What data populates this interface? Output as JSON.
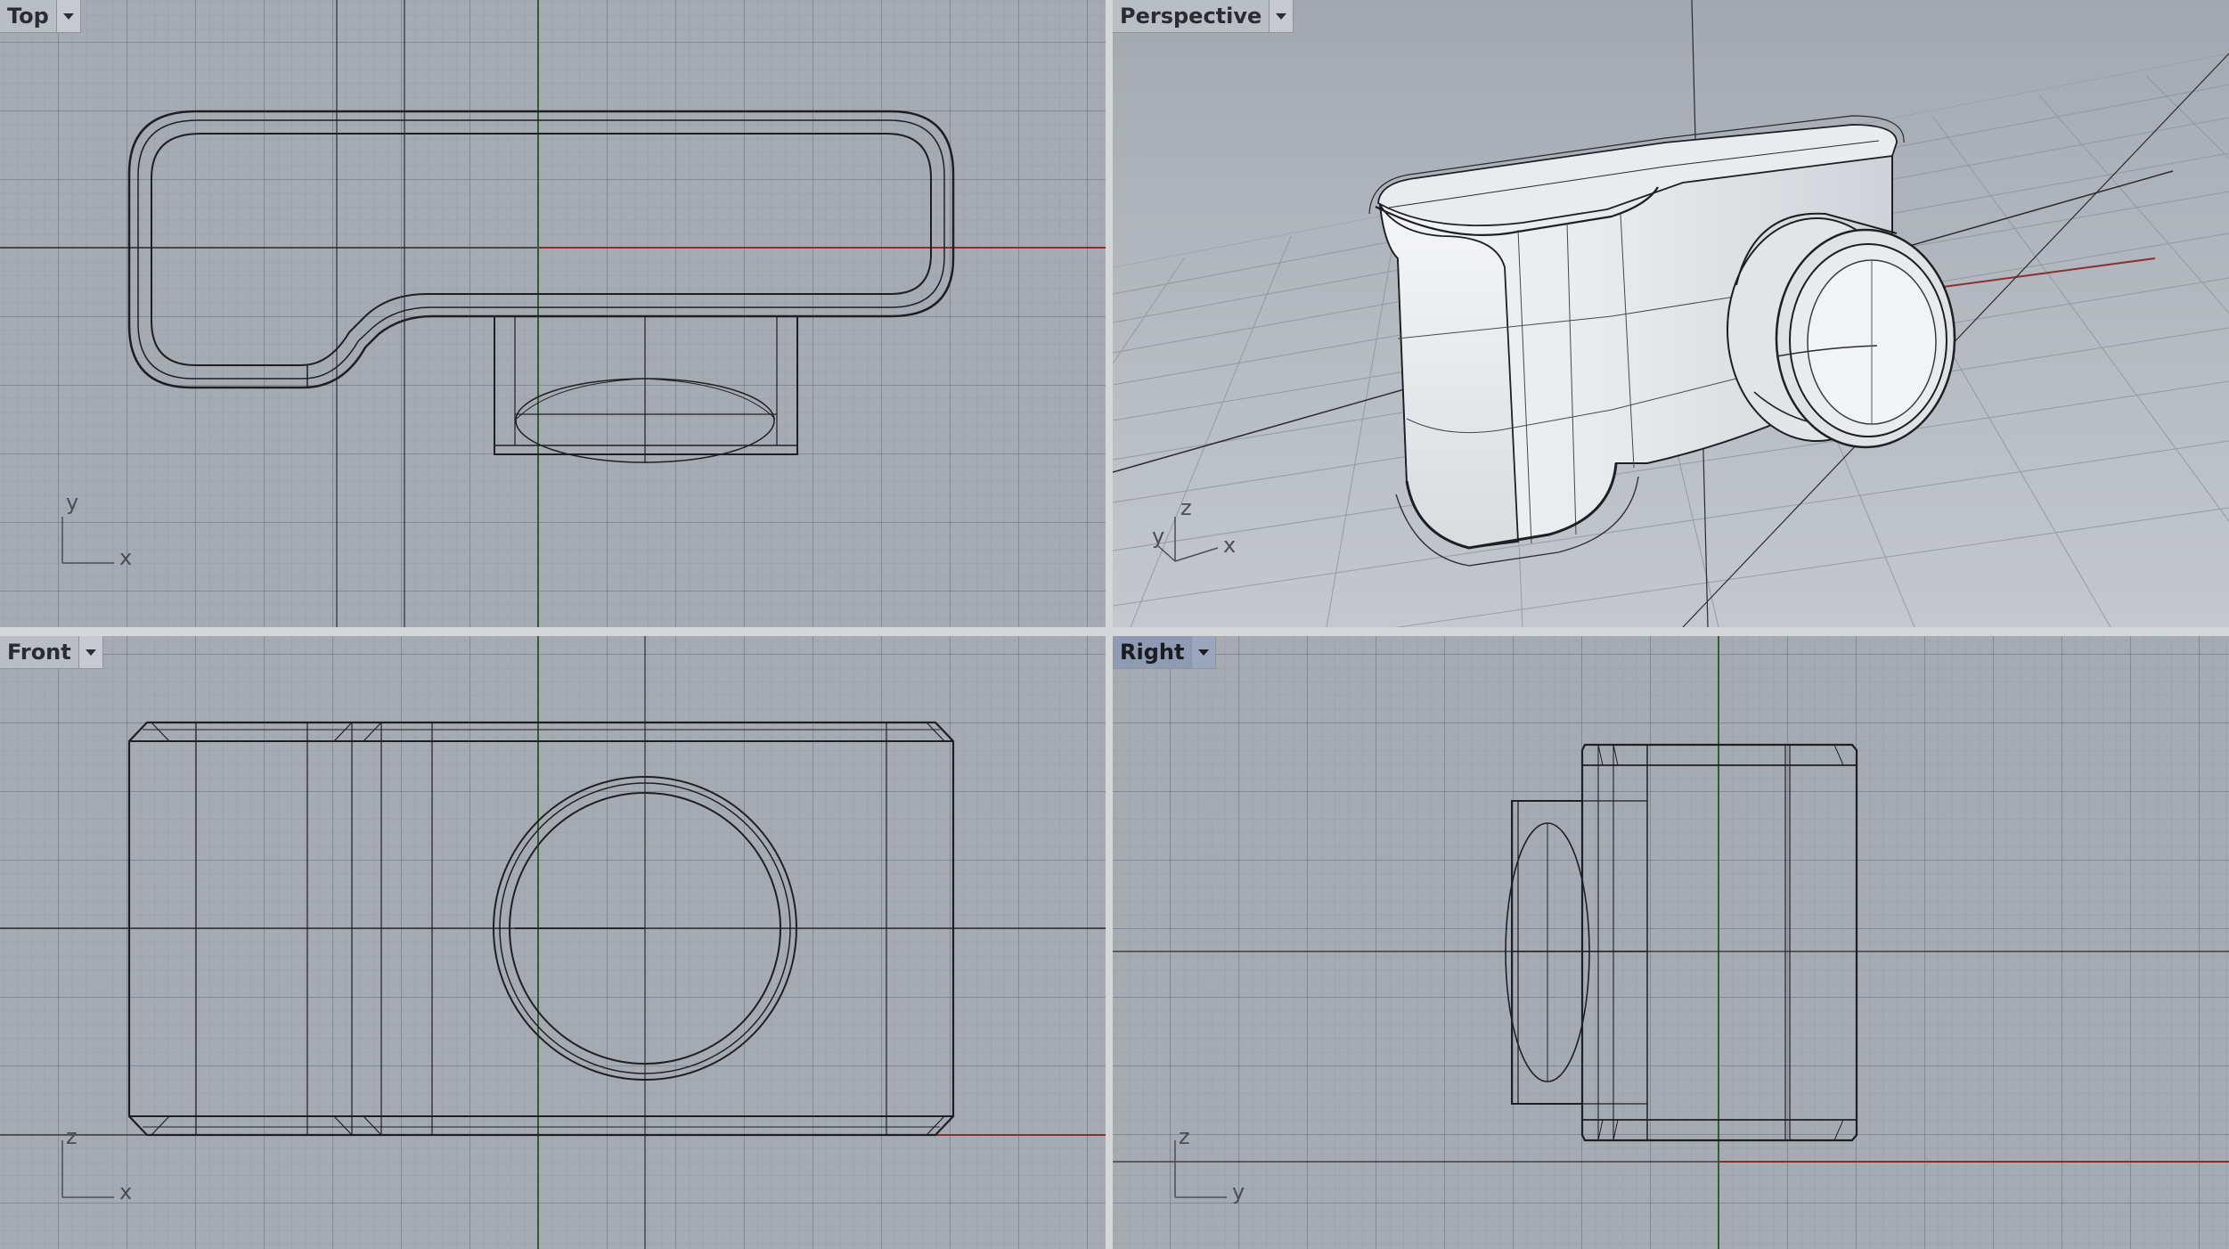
{
  "viewports": {
    "top": {
      "title": "Top",
      "axis_h": "x",
      "axis_v": "y"
    },
    "perspective": {
      "title": "Perspective",
      "axis_x": "x",
      "axis_y": "y",
      "axis_z": "z"
    },
    "front": {
      "title": "Front",
      "axis_h": "x",
      "axis_v": "z"
    },
    "right": {
      "title": "Right",
      "axis_h": "y",
      "axis_v": "z"
    }
  },
  "active_viewport": "right",
  "icons": {
    "menu": "chevron-down-icon"
  },
  "colors": {
    "viewport_bg": "#a6abb3",
    "grid_major": "#6e747e",
    "axis_x": "#8a2e2e",
    "axis_y": "#2f5f2f",
    "wire": "#1e1f22",
    "active_tab": "#8e9bb3"
  }
}
